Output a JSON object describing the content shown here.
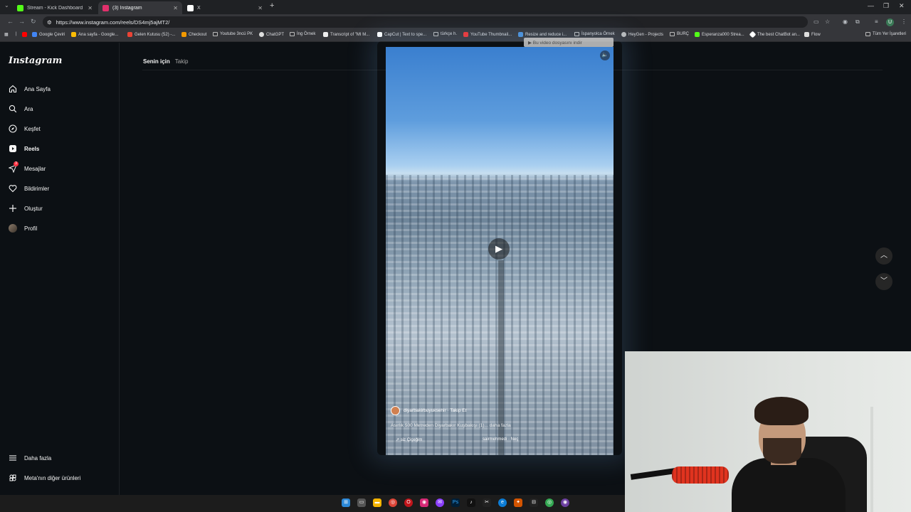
{
  "browser": {
    "tabs": [
      {
        "title": "Stream - Kick Dashboard",
        "favicon_color": "#53fc18"
      },
      {
        "title": "(3) Instagram",
        "favicon_color": "#e1306c"
      },
      {
        "title": "X",
        "favicon_color": "#ffffff"
      }
    ],
    "url": "https://www.instagram.com/reels/DS4mj5ajMT2/",
    "bookmarks": [
      {
        "label": "Google Çeviri",
        "icon": "google-translate-icon"
      },
      {
        "label": "Ana sayfa - Google...",
        "icon": "google-drive-icon"
      },
      {
        "label": "Gelen Kutusu (52) -...",
        "icon": "gmail-icon"
      },
      {
        "label": "Checkout",
        "icon": "checkout-icon"
      },
      {
        "label": "Youtube 3ncü PK",
        "icon": "folder-icon"
      },
      {
        "label": "ChatGPT",
        "icon": "chatgpt-icon"
      },
      {
        "label": "İng Örnek",
        "icon": "folder-icon"
      },
      {
        "label": "Transcript of \"MI M...",
        "icon": "doc-icon"
      },
      {
        "label": "CapCut | Text to spe...",
        "icon": "capcut-icon"
      },
      {
        "label": "türkçe h.",
        "icon": "folder-icon"
      },
      {
        "label": "YouTube Thumbnail...",
        "icon": "youtube-icon"
      },
      {
        "label": "Resize and reduce i...",
        "icon": "image-icon"
      },
      {
        "label": "İspanyolca Örnek",
        "icon": "folder-icon"
      },
      {
        "label": "HeyGen - Projects",
        "icon": "heygen-icon"
      },
      {
        "label": "BURÇ",
        "icon": "folder-icon"
      },
      {
        "label": "Esperanza000 Strea...",
        "icon": "kick-icon"
      },
      {
        "label": "The best ChatBot an...",
        "icon": "chatbot-icon"
      },
      {
        "label": "Flow",
        "icon": "flow-icon"
      }
    ],
    "all_bookmarks": "Tüm Yer İşaretleri"
  },
  "instagram": {
    "logo": "Instagram",
    "nav": [
      {
        "label": "Ana Sayfa",
        "icon": "home-icon"
      },
      {
        "label": "Ara",
        "icon": "search-icon"
      },
      {
        "label": "Keşfet",
        "icon": "compass-icon"
      },
      {
        "label": "Reels",
        "icon": "reels-icon"
      },
      {
        "label": "Mesajlar",
        "icon": "messenger-icon",
        "badge": "3"
      },
      {
        "label": "Bildirimler",
        "icon": "heart-icon"
      },
      {
        "label": "Oluştur",
        "icon": "plus-icon"
      },
      {
        "label": "Profil",
        "icon": "avatar"
      }
    ],
    "bottom_nav": [
      {
        "label": "Daha fazla",
        "icon": "menu-icon"
      },
      {
        "label": "Meta'nın diğer ürünleri",
        "icon": "meta-icon"
      }
    ],
    "feed_tabs": [
      "Senin için",
      "Takip"
    ],
    "download_bar": "▶ Bu video dosyasını indir",
    "reel": {
      "author": "diyarbakirbuyuksehir · Takip Et",
      "caption": "Asırlık 500 Metreden Diyarbakır Kuşbakışı (1)... daha fazla",
      "music": "↗ siz Çiçeğim",
      "audio": "sairmehmedi · Neç"
    }
  },
  "taskbar": {
    "icons": [
      "windows-icon",
      "task-view-icon",
      "explorer-icon",
      "chrome-icon",
      "opera-icon",
      "instagram-icon",
      "messenger-icon",
      "photoshop-icon",
      "tiktok-icon",
      "capcut-icon",
      "edge-icon",
      "app-icon",
      "chrome2-icon",
      "obs-icon"
    ]
  }
}
